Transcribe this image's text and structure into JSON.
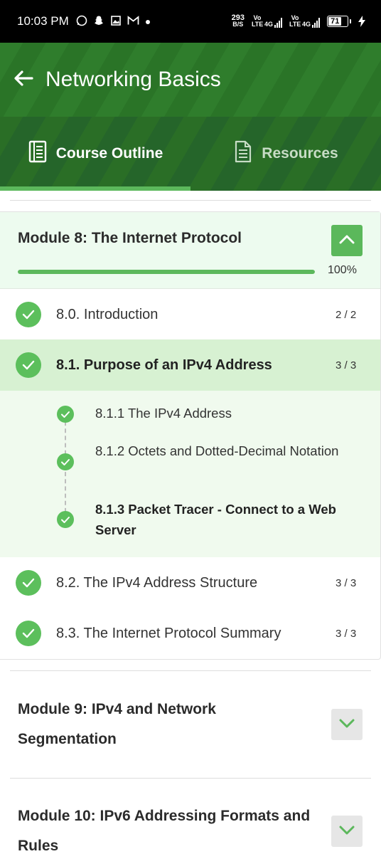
{
  "status_bar": {
    "time": "10:03 PM",
    "left_icons": [
      "whatsapp-icon",
      "snapchat-icon",
      "gallery-icon",
      "gmail-icon",
      "dot-icon"
    ],
    "net_speed_value": "293",
    "net_speed_unit": "B/S",
    "sim1_label": "Vo LTE",
    "sim1_net": "4G",
    "sim2_label": "Vo LTE",
    "sim2_net": "4G",
    "battery": "71",
    "charging": true
  },
  "header": {
    "title": "Networking Basics"
  },
  "tabs": [
    {
      "label": "Course Outline",
      "icon": "course-outline-icon",
      "active": true
    },
    {
      "label": "Resources",
      "icon": "document-icon",
      "active": false
    }
  ],
  "colors": {
    "header_green": "#2f7d2c",
    "accent_green": "#5cb85c",
    "module_head_bg": "#edfbef",
    "active_lesson_bg": "#d7f1d2"
  },
  "module_8": {
    "title": "Module 8: The Internet Protocol",
    "progress_text": "100%",
    "progress_fraction": 1.0,
    "expanded": true,
    "lessons": [
      {
        "label": "8.0. Introduction",
        "count": "2 / 2",
        "completed": true,
        "active": false
      },
      {
        "label": "8.1. Purpose of an IPv4 Address",
        "count": "3 / 3",
        "completed": true,
        "active": true
      },
      {
        "label": "8.2. The IPv4 Address Structure",
        "count": "3 / 3",
        "completed": true,
        "active": false
      },
      {
        "label": "8.3. The Internet Protocol Summary",
        "count": "3 / 3",
        "completed": true,
        "active": false
      }
    ],
    "sub_topics": [
      {
        "label": "8.1.1 The IPv4 Address",
        "completed": true,
        "current": false
      },
      {
        "label": "8.1.2 Octets and Dotted-Decimal Notation",
        "completed": true,
        "current": false
      },
      {
        "label": "8.1.3 Packet Tracer - Connect to a Web Server",
        "completed": true,
        "current": true
      }
    ]
  },
  "collapsed_modules": [
    {
      "title": "Module 9: IPv4 and Network Segmentation"
    },
    {
      "title": "Module 10: IPv6 Addressing Formats and Rules"
    }
  ]
}
